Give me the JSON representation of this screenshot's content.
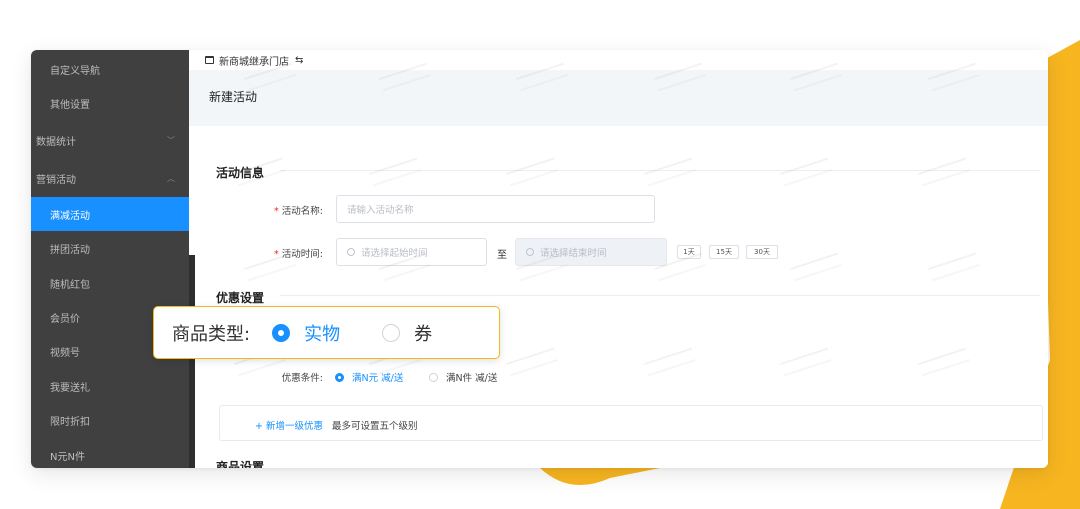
{
  "colors": {
    "accent": "#1890ff",
    "sidebar_bg": "#404040",
    "highlight": "#f5b71d",
    "deco_yellow": "#f7b520"
  },
  "sidebar": {
    "items": [
      {
        "label": "自定义导航",
        "type": "sub"
      },
      {
        "label": "其他设置",
        "type": "sub"
      },
      {
        "label": "数据统计",
        "type": "group",
        "chevron": "chevron-down-icon"
      },
      {
        "label": "营销活动",
        "type": "group",
        "chevron": "chevron-up-icon"
      },
      {
        "label": "满减活动",
        "type": "sub",
        "active": true
      },
      {
        "label": "拼团活动",
        "type": "sub"
      },
      {
        "label": "随机红包",
        "type": "sub"
      },
      {
        "label": "会员价",
        "type": "sub"
      },
      {
        "label": "视频号",
        "type": "sub"
      },
      {
        "label": "我要送礼",
        "type": "sub"
      },
      {
        "label": "限时折扣",
        "type": "sub"
      },
      {
        "label": "N元N件",
        "type": "sub"
      }
    ]
  },
  "topbar": {
    "store_name": "新商城继承门店",
    "swap_symbol": "⇆"
  },
  "page": {
    "title": "新建活动"
  },
  "activity_info": {
    "section_title": "活动信息",
    "name_label": "活动名称:",
    "name_placeholder": "请输入活动名称",
    "time_label": "活动时间:",
    "start_placeholder": "请选择起始时间",
    "separator": "至",
    "end_placeholder": "请选择结束时间",
    "quick_ranges": [
      "1天",
      "15天",
      "30天"
    ]
  },
  "discount": {
    "section_title": "优惠设置",
    "condition_label": "优惠条件:",
    "options": [
      {
        "label": "满N元 减/送",
        "selected": true
      },
      {
        "label": "满N件 减/送",
        "selected": false
      }
    ],
    "add_link": "+ 新增一级优惠",
    "add_tip": "最多可设置五个级别"
  },
  "goods": {
    "section_title": "商品设置"
  },
  "callout": {
    "label": "商品类型:",
    "options": [
      {
        "label": "实物",
        "selected": true
      },
      {
        "label": "券",
        "selected": false
      }
    ]
  }
}
